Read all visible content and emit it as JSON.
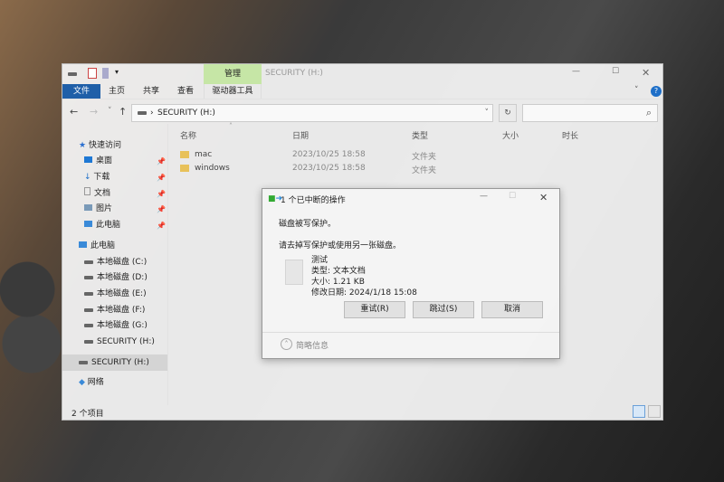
{
  "window": {
    "title": "SECURITY (H:)",
    "context_tab": "管理",
    "minimize": "—",
    "maximize": "☐",
    "close": "✕",
    "help": "?"
  },
  "ribbon": {
    "tabs": [
      "文件",
      "主页",
      "共享",
      "查看",
      "驱动器工具"
    ]
  },
  "address": {
    "path": "SECURITY (H:)",
    "refresh": "↻",
    "search_icon": "⌕"
  },
  "nav": {
    "back": "←",
    "forward": "→",
    "recent": "˅",
    "up": "↑"
  },
  "sidebar": {
    "quick_access": "快速访问",
    "quick": [
      {
        "label": "桌面"
      },
      {
        "label": "下载"
      },
      {
        "label": "文档"
      },
      {
        "label": "图片"
      },
      {
        "label": "此电脑"
      }
    ],
    "this_pc": "此电脑",
    "drives": [
      "本地磁盘 (C:)",
      "本地磁盘 (D:)",
      "本地磁盘 (E:)",
      "本地磁盘 (F:)",
      "本地磁盘 (G:)",
      "SECURITY (H:)"
    ],
    "selected": "SECURITY (H:)",
    "network": "网络"
  },
  "columns": [
    "名称",
    "日期",
    "类型",
    "大小",
    "时长"
  ],
  "files": [
    {
      "name": "mac",
      "date": "2023/10/25 18:58",
      "type": "文件夹"
    },
    {
      "name": "windows",
      "date": "2023/10/25 18:58",
      "type": "文件夹"
    }
  ],
  "status": "2 个项目",
  "dialog": {
    "title": "1 个已中断的操作",
    "message": "磁盘被写保护。",
    "hint": "请去掉写保护或使用另一张磁盘。",
    "file_name": "测试",
    "file_type": "类型: 文本文档",
    "file_size": "大小: 1.21 KB",
    "file_modified": "修改日期: 2024/1/18 15:08",
    "retry": "重试(R)",
    "skip": "跳过(S)",
    "cancel": "取消",
    "details": "简略信息",
    "minimize": "—",
    "maximize": "☐",
    "close": "✕"
  }
}
